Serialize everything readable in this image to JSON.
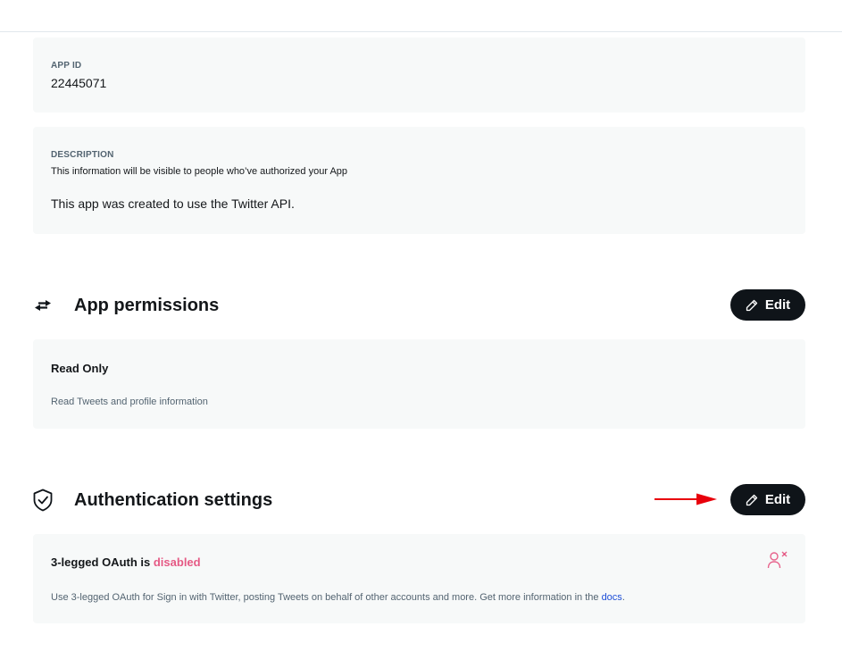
{
  "app_id": {
    "label": "APP ID",
    "value": "22445071"
  },
  "description": {
    "label": "DESCRIPTION",
    "hint": "This information will be visible to people who’ve authorized your App",
    "value": "This app was created to use the Twitter API."
  },
  "permissions": {
    "title": "App permissions",
    "edit_label": "Edit",
    "level": "Read Only",
    "level_description": "Read Tweets and profile information"
  },
  "authentication": {
    "title": "Authentication settings",
    "edit_label": "Edit",
    "oauth_prefix": "3-legged OAuth is",
    "oauth_status": "disabled",
    "oauth_description": "Use 3-legged OAuth for Sign in with Twitter, posting Tweets on behalf of other accounts and more. Get more information in the",
    "docs_link": "docs",
    "docs_suffix": "."
  },
  "icons": {
    "permissions": "swap-arrows-icon",
    "authentication": "shield-check-icon",
    "edit": "pencil-icon",
    "oauth_state": "user-x-icon",
    "annotation": "red-arrow"
  },
  "colors": {
    "button_bg": "#0f1419",
    "card_bg": "#f7f9f9",
    "disabled": "#e0245e",
    "link": "#1d4ed8",
    "annotation_arrow": "#e8000b"
  }
}
